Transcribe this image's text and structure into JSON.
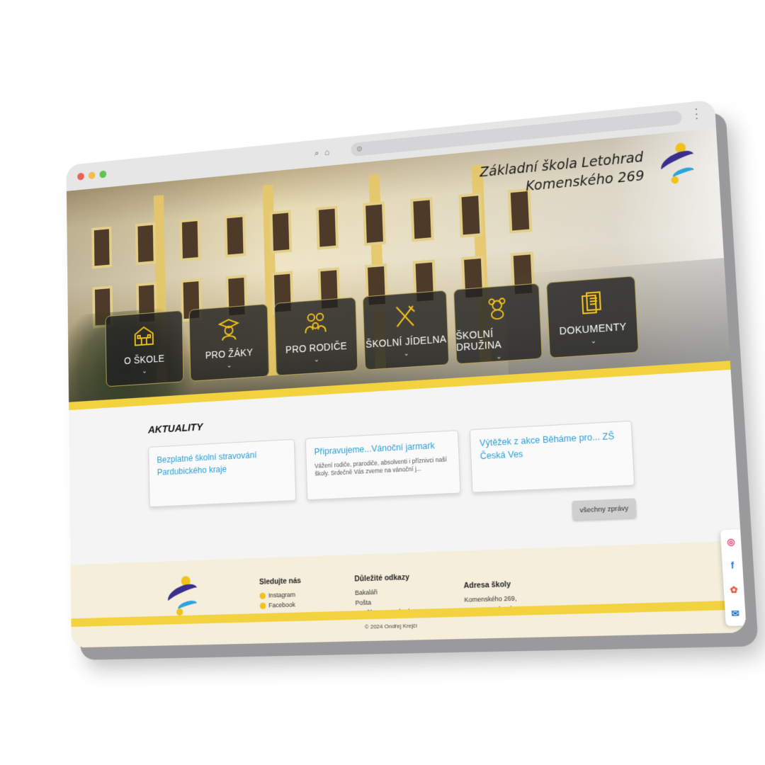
{
  "browser": {
    "url": "",
    "menu_glyph": "⋮",
    "search_glyph": "⌕",
    "home_glyph": "⌂",
    "lock_glyph": "⊜"
  },
  "header": {
    "school_name": "Základní škola Letohrad",
    "street": "Komenského 269"
  },
  "nav": {
    "items": [
      {
        "label": "O ŠKOLE",
        "icon": "school-building-icon"
      },
      {
        "label": "PRO ŽÁKY",
        "icon": "graduate-icon"
      },
      {
        "label": "PRO RODIČE",
        "icon": "family-icon"
      },
      {
        "label": "ŠKOLNÍ JÍDELNA",
        "icon": "cutlery-icon"
      },
      {
        "label": "ŠKOLNÍ DRUŽINA",
        "icon": "teddy-bear-icon"
      },
      {
        "label": "DOKUMENTY",
        "icon": "documents-icon"
      }
    ],
    "chevron": "⌄"
  },
  "news": {
    "heading": "AKTUALITY",
    "items": [
      {
        "title": "Bezplatné školní stravování Pardubického kraje",
        "excerpt": ""
      },
      {
        "title": "Připravujeme...Vánoční jarmark",
        "excerpt": "Vážení rodiče, prarodiče, absolventi i příznivci naší školy. Srdečně Vás zveme na vánoční j..."
      },
      {
        "title": "Výtěžek z akce Běháme pro... ZŠ Česká Ves",
        "excerpt": ""
      }
    ],
    "all_label": "všechny zprávy"
  },
  "footer": {
    "follow_heading": "Sledujte nás",
    "follow_links": [
      "Instagram",
      "Facebook"
    ],
    "links_heading": "Důležité odkazy",
    "links": [
      "Bakaláři",
      "Pošta",
      "Starší verze stránek"
    ],
    "address_heading": "Adresa školy",
    "address_line1": "Komenského 269,",
    "address_line2": "561 51 Letohrad",
    "copyright": "© 2024 Ondřej Krejčí"
  },
  "side_social": [
    {
      "icon": "instagram-icon",
      "glyph": "◎",
      "color": "#e1306c"
    },
    {
      "icon": "facebook-icon",
      "glyph": "f",
      "color": "#1877f2"
    },
    {
      "icon": "photos-icon",
      "glyph": "✿",
      "color": "#e2543a"
    },
    {
      "icon": "outlook-icon",
      "glyph": "✉",
      "color": "#0a64c9"
    }
  ],
  "colors": {
    "accent_yellow": "#f2d23e",
    "link_blue": "#2a9fd8",
    "logo_purple": "#3a2f8c",
    "tile_border": "#b9a35a"
  }
}
